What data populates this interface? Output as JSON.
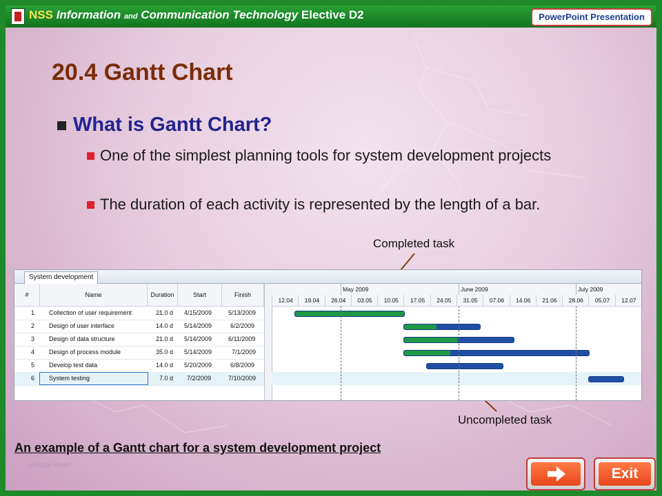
{
  "header": {
    "nss": "NSS",
    "title_a": "Information",
    "title_and": "and",
    "title_b": "Communication Technology",
    "elective": "Elective D2",
    "ppt_button": "PowerPoint Presentation"
  },
  "slide": {
    "title": "20.4 Gantt Chart",
    "bullet": "What is Gantt Chart?",
    "sub_bullets": [
      "One of the simplest planning tools for system development projects",
      "The duration of each activity is represented by the length of a bar."
    ],
    "callout_completed": "Completed task",
    "callout_uncompleted": "Uncompleted task",
    "caption": "An example of a Gantt chart for a system development project",
    "faint_footer": "Vorlage Ideen"
  },
  "gantt": {
    "tab": "System development",
    "columns": [
      "#",
      "Name",
      "Duration",
      "Start",
      "Finish"
    ],
    "rows": [
      {
        "num": "1",
        "name": "Collection of user requirement",
        "duration": "21.0 d",
        "start": "4/15/2009",
        "finish": "5/13/2009",
        "progress": 1.0
      },
      {
        "num": "2",
        "name": "Design of user interface",
        "duration": "14.0 d",
        "start": "5/14/2009",
        "finish": "6/2/2009",
        "progress": 0.43
      },
      {
        "num": "3",
        "name": "Design of data structure",
        "duration": "21.0 d",
        "start": "5/14/2009",
        "finish": "6/11/2009",
        "progress": 0.48
      },
      {
        "num": "4",
        "name": "Design of process module",
        "duration": "35.0 d",
        "start": "5/14/2009",
        "finish": "7/1/2009",
        "progress": 0.25
      },
      {
        "num": "5",
        "name": "Develop test data",
        "duration": "14.0 d",
        "start": "5/20/2009",
        "finish": "6/8/2009",
        "progress": 0.0
      },
      {
        "num": "6",
        "name": "System testing",
        "duration": "7.0 d",
        "start": "7/2/2009",
        "finish": "7/10/2009",
        "progress": 0.0
      }
    ],
    "months": [
      "May 2009",
      "June 2009",
      "July 2009"
    ],
    "weeks": [
      "12.04",
      "19.04",
      "26.04",
      "03.05",
      "10.05",
      "17.05",
      "24.05",
      "31.05",
      "07.06",
      "14.06",
      "21.06",
      "28.06",
      "05.07",
      "12.07"
    ],
    "selected_row": "6",
    "colors": {
      "completed": "#1e9a44",
      "uncompleted": "#1f4fa6"
    }
  },
  "nav": {
    "next_icon": "right-arrow-icon",
    "exit_label": "Exit"
  }
}
